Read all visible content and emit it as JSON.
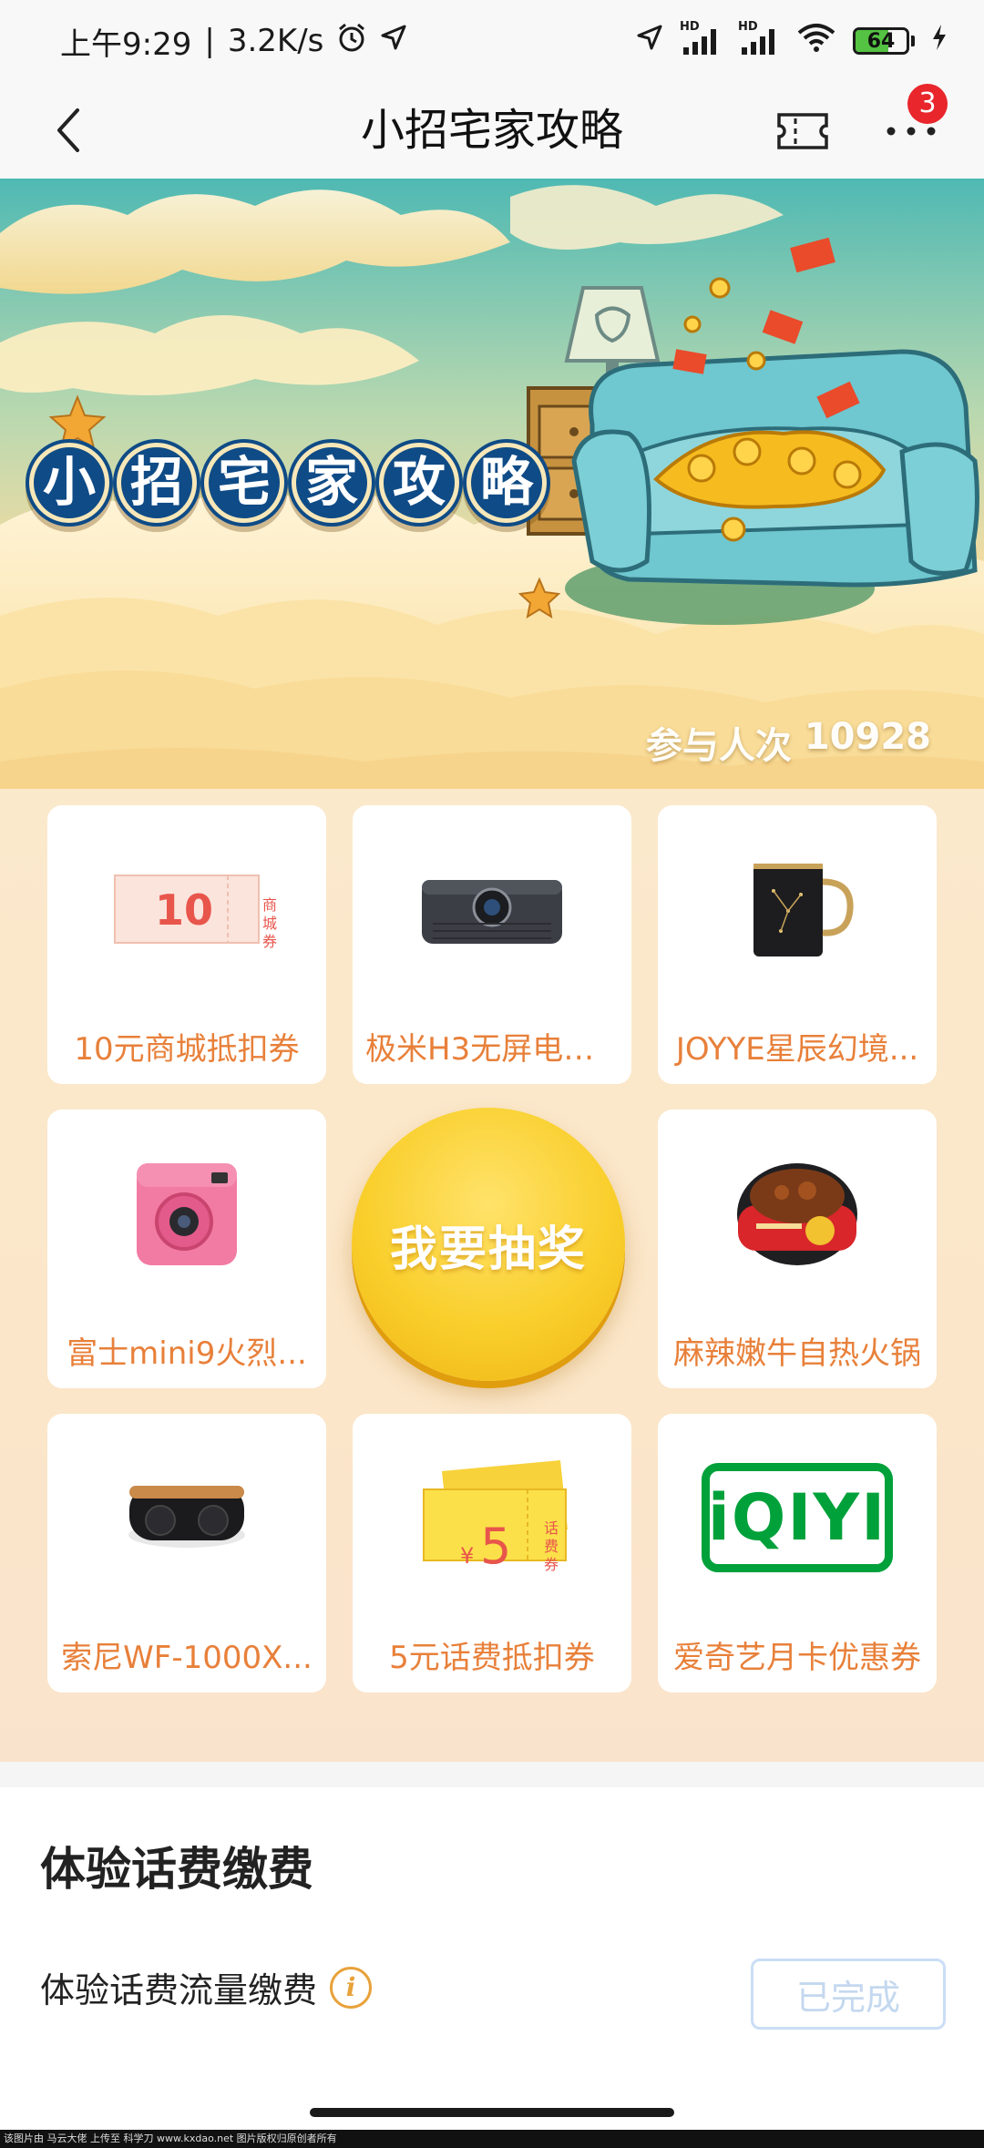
{
  "status_bar": {
    "time": "上午9:29",
    "network_speed": "3.2K/s",
    "battery_level": "64",
    "battery_fraction": 0.64,
    "signal_1": "HD",
    "signal_2": "HD"
  },
  "nav": {
    "title": "小招宅家攻略",
    "badge_count": "3"
  },
  "banner": {
    "title_chars": [
      "小",
      "招",
      "宅",
      "家",
      "攻",
      "略"
    ],
    "participants_label": "参与人次",
    "participants_count": "10928"
  },
  "prizes": [
    {
      "label": "10元商城抵扣券",
      "coupon_value": "10",
      "coupon_tag": "商城券"
    },
    {
      "label": "极米H3无屏电视..."
    },
    {
      "label": "JOYYE星辰幻境..."
    },
    {
      "label": "富士mini9火烈..."
    },
    {
      "label": "麻辣嫩牛自热火锅"
    },
    {
      "label": "索尼WF-1000X..."
    },
    {
      "label": "5元话费抵扣券",
      "coupon_value": "5",
      "coupon_tag": "话费券",
      "coupon_currency": "¥"
    },
    {
      "label": "爱奇艺月卡优惠券",
      "logo_text": "iQIYI"
    }
  ],
  "draw_button": {
    "label": "我要抽奖"
  },
  "task": {
    "heading": "体验话费缴费",
    "item_label": "体验话费流量缴费",
    "info_icon_glyph": "i",
    "status_label": "已完成"
  },
  "watermark": "该图片由 马云大佬 上传至 科学刀 www.kxdao.net 图片版权归原创者所有",
  "colors": {
    "prize_label": "#e8803a",
    "draw_button": "#f9cf2c",
    "badge": "#e8262c",
    "done_border": "#c9def5"
  }
}
